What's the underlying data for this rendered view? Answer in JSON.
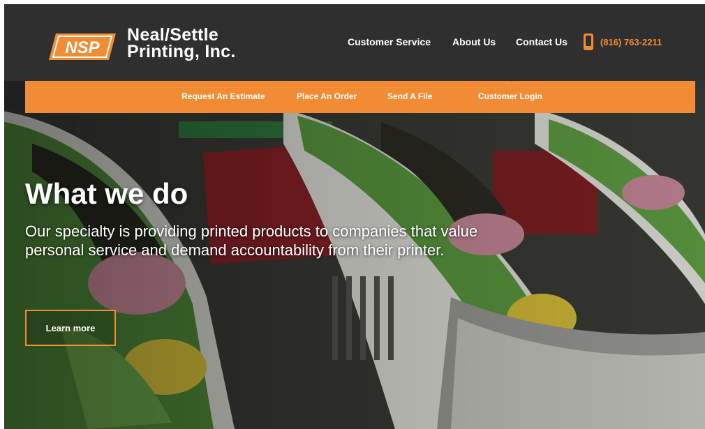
{
  "brand": {
    "logo_text": "NSP",
    "name_line1": "Neal/Settle",
    "name_line2": "Printing, Inc."
  },
  "topnav": {
    "items": [
      {
        "label": "Customer Service"
      },
      {
        "label": "About Us"
      },
      {
        "label": "Contact Us"
      }
    ],
    "phone": "(816) 763-2211",
    "phone_icon": "mobile-phone-icon"
  },
  "subnav": {
    "items": [
      {
        "label": "Request An Estimate"
      },
      {
        "label": "Place An Order"
      },
      {
        "label": "Send A File"
      },
      {
        "label": "Customer Login"
      }
    ]
  },
  "hero": {
    "title": "What we do",
    "copy": "Our specialty is providing printed products to companies that value personal service and demand accountability from their printer.",
    "button": "Learn more"
  },
  "colors": {
    "accent": "#f28c34",
    "header_bg": "#2f2f2f"
  }
}
